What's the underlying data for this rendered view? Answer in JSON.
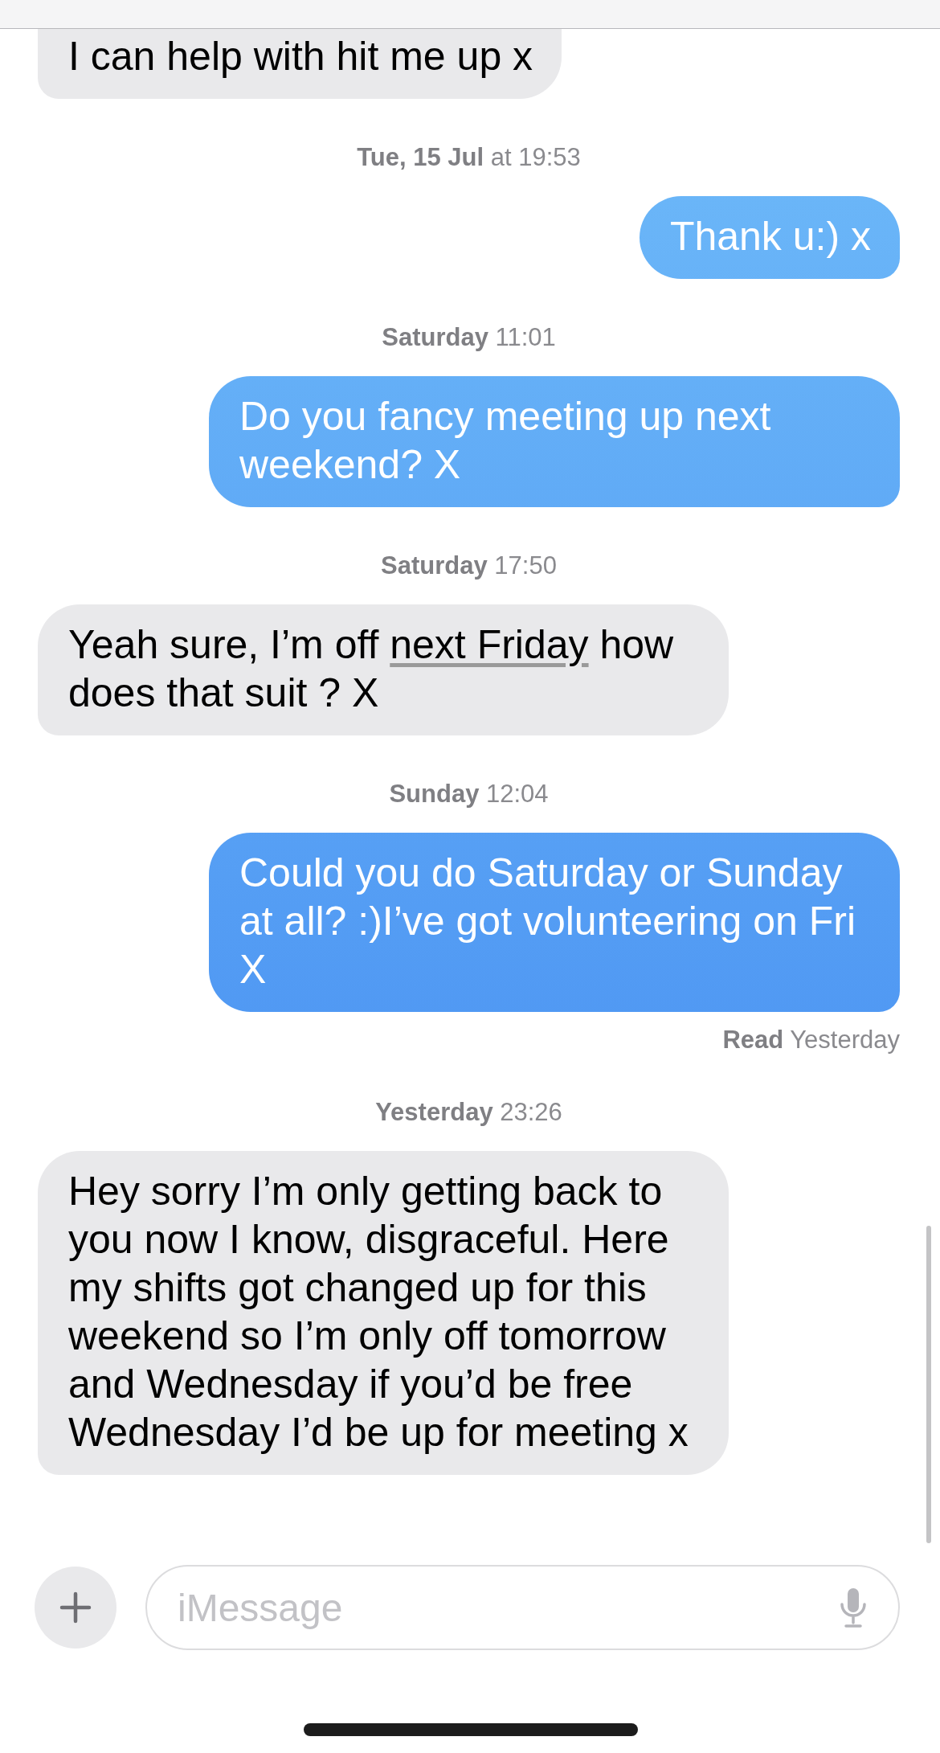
{
  "thread": [
    {
      "kind": "received",
      "segments": [
        {
          "kind": "plain",
          "text": "I can help with hit me up x"
        }
      ]
    },
    {
      "kind": "timestamp",
      "text": "**Tue, 15 Jul** at 19:53"
    },
    {
      "kind": "sent",
      "segments": [
        {
          "kind": "plain",
          "text": "Thank u:) x"
        }
      ]
    },
    {
      "kind": "timestamp",
      "text": "**Saturday** 11:01"
    },
    {
      "kind": "sent",
      "segments": [
        {
          "kind": "plain",
          "text": "Do you fancy meeting up next weekend? X"
        }
      ]
    },
    {
      "kind": "timestamp",
      "text": "**Saturday** 17:50"
    },
    {
      "kind": "received",
      "segments": [
        {
          "kind": "plain",
          "text": "Yeah sure, I’m off "
        },
        {
          "kind": "detected",
          "text": "next Friday"
        },
        {
          "kind": "plain",
          "text": " how does that suit ? X"
        }
      ]
    },
    {
      "kind": "timestamp",
      "text": "**Sunday** 12:04"
    },
    {
      "kind": "sent",
      "segments": [
        {
          "kind": "plain",
          "text": "Could you do Saturday or Sunday at all? :)I’ve got volunteering on Fri X"
        }
      ]
    },
    {
      "kind": "receipt",
      "text": "**Read** Yesterday"
    },
    {
      "kind": "timestamp",
      "text": "**Yesterday** 23:26"
    },
    {
      "kind": "received",
      "segments": [
        {
          "kind": "plain",
          "text": "Hey sorry I’m only getting back to you now I know, disgraceful. Here my shifts got changed up for this weekend so I’m only off tomorrow and Wednesday if you’d be free Wednesday I’d be up for meeting x"
        }
      ]
    }
  ],
  "composer": {
    "placeholder": "iMessage"
  }
}
